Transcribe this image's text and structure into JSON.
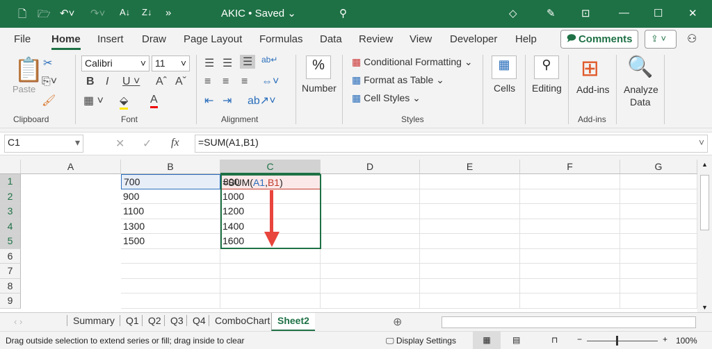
{
  "title": {
    "doc": "AKIC • Saved ⌄",
    "overflow": "»"
  },
  "menu": [
    "File",
    "Home",
    "Insert",
    "Draw",
    "Page Layout",
    "Formulas",
    "Data",
    "Review",
    "View",
    "Developer",
    "Help"
  ],
  "comments_label": "Comments",
  "ribbon": {
    "paste": "Paste",
    "font_name": "Calibri",
    "font_size": "11",
    "groups": {
      "clipboard": "Clipboard",
      "font": "Font",
      "alignment": "Alignment",
      "styles": "Styles",
      "addins": "Add-ins"
    },
    "number": "Number",
    "cond_format": "Conditional Formatting ⌄",
    "format_table": "Format as Table ⌄",
    "cell_styles": "Cell Styles ⌄",
    "cells": "Cells",
    "editing": "Editing",
    "addins_btn": "Add-ins",
    "analyze1": "Analyze",
    "analyze2": "Data"
  },
  "namebox": "C1",
  "formula": "=SUM(A1,B1)",
  "columns": [
    "A",
    "B",
    "C",
    "D",
    "E",
    "F",
    "G"
  ],
  "rows": [
    "1",
    "2",
    "3",
    "4",
    "5",
    "6",
    "7",
    "8",
    "9"
  ],
  "cells": {
    "A": [
      "700",
      "900",
      "1100",
      "1300",
      "1500"
    ],
    "B": [
      "800",
      "1000",
      "1200",
      "1400",
      "1600"
    ]
  },
  "c1": {
    "pre": "=SUM(",
    "a": "A1",
    ",": ",",
    "b": "B1",
    "post": ")"
  },
  "sheets": [
    "Summary",
    "Q1",
    "Q2",
    "Q3",
    "Q4",
    "ComboChart",
    "Sheet2"
  ],
  "status": {
    "message": "Drag outside selection to extend series or fill; drag inside to clear",
    "display": "Display Settings",
    "zoom": "100%"
  },
  "colors": {
    "green": "#1e7145",
    "arrow": "#e8453c"
  }
}
